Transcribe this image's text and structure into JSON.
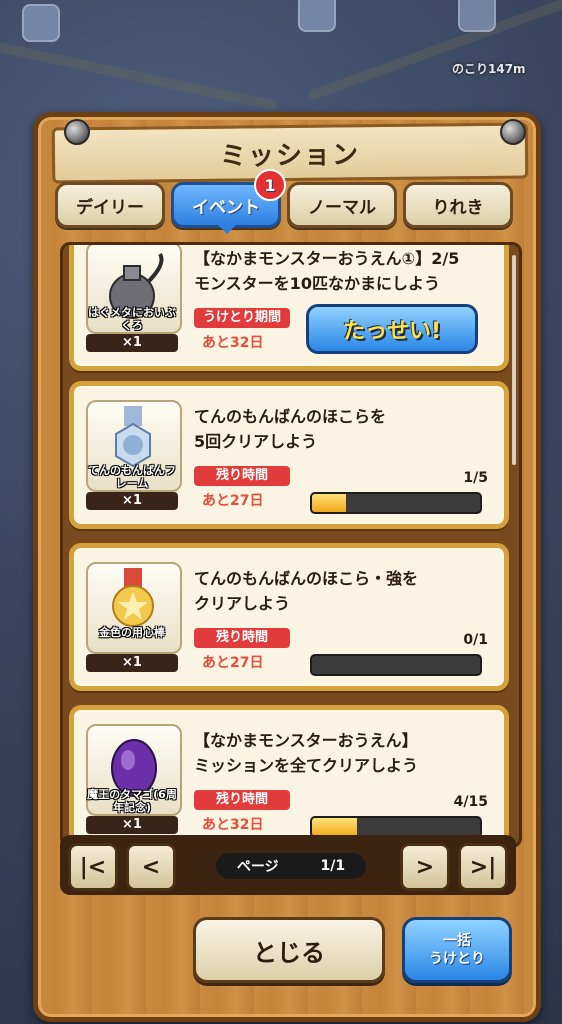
{
  "background": {
    "remaining_label": "のこり147m"
  },
  "panel": {
    "title": "ミッション"
  },
  "tabs": [
    {
      "label": "デイリー",
      "active": false
    },
    {
      "label": "イベント",
      "active": true,
      "badge": "1"
    },
    {
      "label": "ノーマル",
      "active": false
    },
    {
      "label": "りれき",
      "active": false
    }
  ],
  "missions": [
    {
      "reward_name": "はぐメタにおいぶくろ",
      "reward_qty": "×1",
      "title_line1": "【なかまモンスターおうえん①】2/5",
      "title_line2": "モンスターを10匹なかまにしよう",
      "time_label": "うけとり期間",
      "remaining": "あと32日",
      "button": "たっせい!",
      "icon": "pouch-icon"
    },
    {
      "reward_name": "てんのもんばんフレーム",
      "reward_qty": "×1",
      "title_line1": "てんのもんばんのほこらを",
      "title_line2": "5回クリアしよう",
      "time_label": "残り時間",
      "remaining": "あと27日",
      "count": "1/5",
      "progress": 0.2,
      "icon": "medal-icon"
    },
    {
      "reward_name": "金色の用心棒",
      "reward_qty": "×1",
      "title_line1": "てんのもんばんのほこら・強を",
      "title_line2": "クリアしよう",
      "time_label": "残り時間",
      "remaining": "あと27日",
      "count": "0/1",
      "progress": 0.0,
      "icon": "gold-medal-icon"
    },
    {
      "reward_name": "魔王のタマゴ(6周年記念)",
      "reward_qty": "×1",
      "title_line1": "【なかまモンスターおうえん】",
      "title_line2": "ミッションを全てクリアしよう",
      "time_label": "残り時間",
      "remaining": "あと32日",
      "count": "4/15",
      "progress": 0.27,
      "icon": "egg-icon"
    }
  ],
  "pager": {
    "label": "ページ",
    "value": "1/1"
  },
  "buttons": {
    "close": "とじる",
    "bulk_line1": "一括",
    "bulk_line2": "うけとり"
  },
  "colors": {
    "accent_blue": "#2b86e6",
    "time_red": "#e23b3b",
    "wood": "#c98a3f"
  }
}
